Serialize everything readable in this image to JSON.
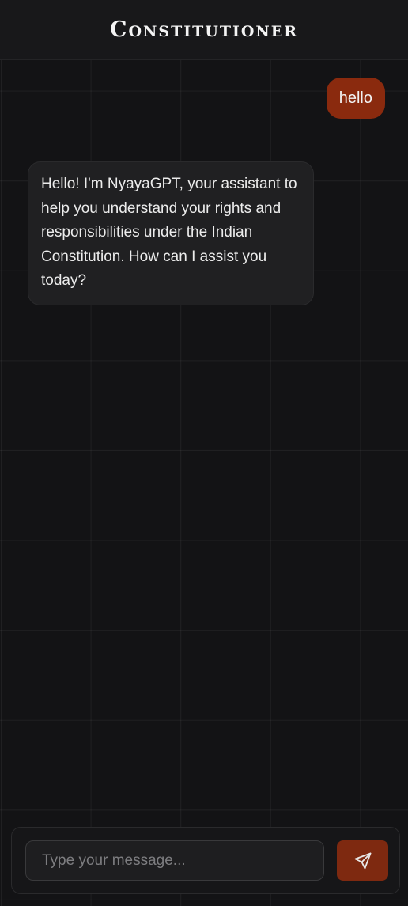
{
  "header": {
    "title": "Constitutioner"
  },
  "messages": [
    {
      "role": "user",
      "text": "hello"
    },
    {
      "role": "assistant",
      "text": "Hello! I'm NyayaGPT, your assistant to help you understand your rights and responsibilities under the Indian Constitution. How can I assist you today?"
    }
  ],
  "composer": {
    "placeholder": "Type your message...",
    "value": "",
    "send_icon": "send-icon"
  },
  "colors": {
    "accent": "#8a2a0e",
    "background": "#131315",
    "bubble_bot": "#202022"
  }
}
